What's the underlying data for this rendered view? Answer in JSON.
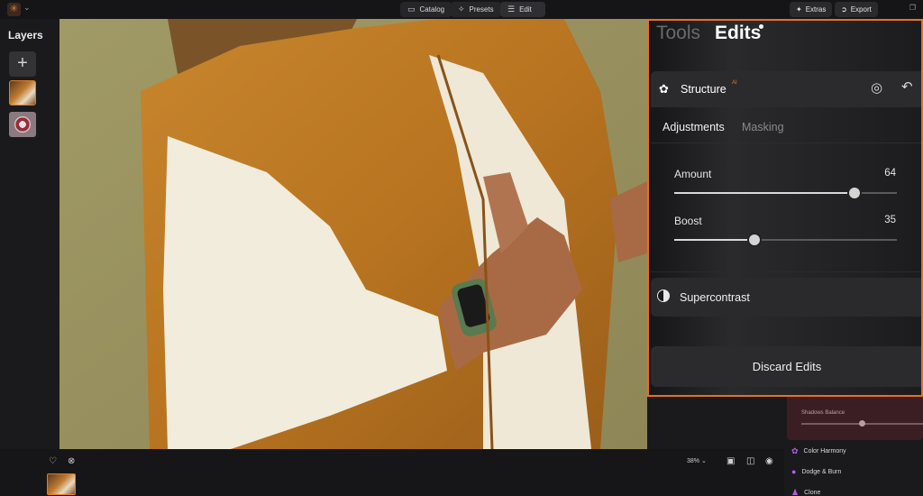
{
  "topbar": {
    "nav": [
      {
        "label": "Catalog",
        "icon": "folder-icon"
      },
      {
        "label": "Presets",
        "icon": "sparkle-icon"
      },
      {
        "label": "Edit",
        "icon": "sliders-icon"
      }
    ],
    "extras_label": "Extras",
    "export_label": "Export"
  },
  "layers": {
    "title": "Layers",
    "add_symbol": "+"
  },
  "panel": {
    "tab_tools": "Tools",
    "tab_edits": "Edits",
    "section": {
      "label": "Structure",
      "badge": "AI"
    },
    "subtabs": {
      "adjustments": "Adjustments",
      "masking": "Masking"
    },
    "sliders": [
      {
        "label": "Amount",
        "value": "64",
        "fraction": 0.81
      },
      {
        "label": "Boost",
        "value": "35",
        "fraction": 0.36
      }
    ],
    "supercontrast_label": "Supercontrast",
    "discard_label": "Discard Edits"
  },
  "behind_panel": {
    "shadows_label": "Shadows Balance",
    "tools": [
      {
        "label": "Color Harmony",
        "icon": "flower-icon"
      },
      {
        "label": "Dodge & Burn",
        "icon": "drop-icon"
      },
      {
        "label": "Clone",
        "icon": "person-icon"
      }
    ]
  },
  "bottombar": {
    "zoom_label": "38%"
  },
  "colors": {
    "accent": "#e8701e",
    "panel_bg": "#2b2b2e"
  }
}
